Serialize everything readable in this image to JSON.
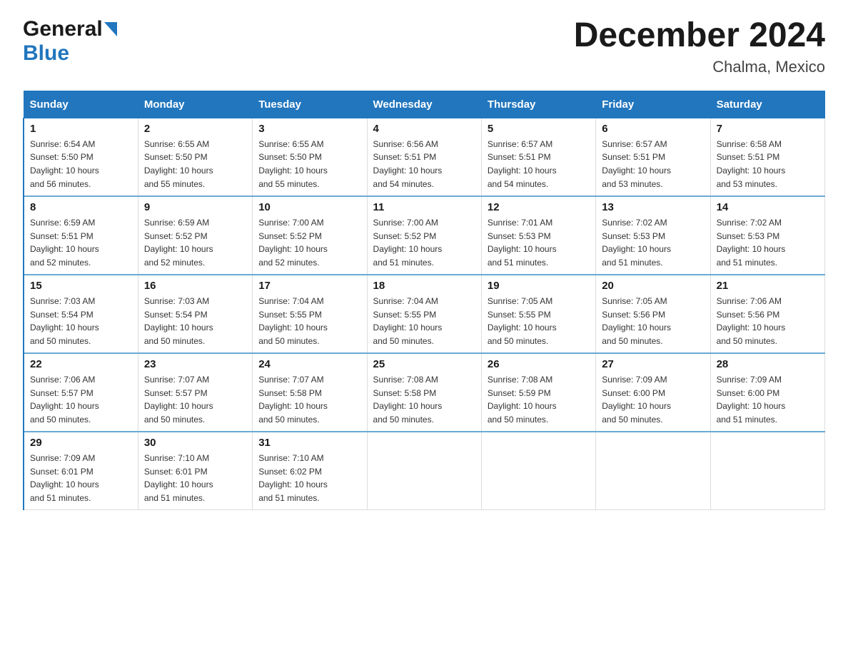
{
  "header": {
    "logo_text_general": "General",
    "logo_text_blue": "Blue",
    "title": "December 2024",
    "subtitle": "Chalma, Mexico"
  },
  "days_of_week": [
    "Sunday",
    "Monday",
    "Tuesday",
    "Wednesday",
    "Thursday",
    "Friday",
    "Saturday"
  ],
  "weeks": [
    [
      {
        "day": "1",
        "sunrise": "6:54 AM",
        "sunset": "5:50 PM",
        "daylight": "10 hours and 56 minutes."
      },
      {
        "day": "2",
        "sunrise": "6:55 AM",
        "sunset": "5:50 PM",
        "daylight": "10 hours and 55 minutes."
      },
      {
        "day": "3",
        "sunrise": "6:55 AM",
        "sunset": "5:50 PM",
        "daylight": "10 hours and 55 minutes."
      },
      {
        "day": "4",
        "sunrise": "6:56 AM",
        "sunset": "5:51 PM",
        "daylight": "10 hours and 54 minutes."
      },
      {
        "day": "5",
        "sunrise": "6:57 AM",
        "sunset": "5:51 PM",
        "daylight": "10 hours and 54 minutes."
      },
      {
        "day": "6",
        "sunrise": "6:57 AM",
        "sunset": "5:51 PM",
        "daylight": "10 hours and 53 minutes."
      },
      {
        "day": "7",
        "sunrise": "6:58 AM",
        "sunset": "5:51 PM",
        "daylight": "10 hours and 53 minutes."
      }
    ],
    [
      {
        "day": "8",
        "sunrise": "6:59 AM",
        "sunset": "5:51 PM",
        "daylight": "10 hours and 52 minutes."
      },
      {
        "day": "9",
        "sunrise": "6:59 AM",
        "sunset": "5:52 PM",
        "daylight": "10 hours and 52 minutes."
      },
      {
        "day": "10",
        "sunrise": "7:00 AM",
        "sunset": "5:52 PM",
        "daylight": "10 hours and 52 minutes."
      },
      {
        "day": "11",
        "sunrise": "7:00 AM",
        "sunset": "5:52 PM",
        "daylight": "10 hours and 51 minutes."
      },
      {
        "day": "12",
        "sunrise": "7:01 AM",
        "sunset": "5:53 PM",
        "daylight": "10 hours and 51 minutes."
      },
      {
        "day": "13",
        "sunrise": "7:02 AM",
        "sunset": "5:53 PM",
        "daylight": "10 hours and 51 minutes."
      },
      {
        "day": "14",
        "sunrise": "7:02 AM",
        "sunset": "5:53 PM",
        "daylight": "10 hours and 51 minutes."
      }
    ],
    [
      {
        "day": "15",
        "sunrise": "7:03 AM",
        "sunset": "5:54 PM",
        "daylight": "10 hours and 50 minutes."
      },
      {
        "day": "16",
        "sunrise": "7:03 AM",
        "sunset": "5:54 PM",
        "daylight": "10 hours and 50 minutes."
      },
      {
        "day": "17",
        "sunrise": "7:04 AM",
        "sunset": "5:55 PM",
        "daylight": "10 hours and 50 minutes."
      },
      {
        "day": "18",
        "sunrise": "7:04 AM",
        "sunset": "5:55 PM",
        "daylight": "10 hours and 50 minutes."
      },
      {
        "day": "19",
        "sunrise": "7:05 AM",
        "sunset": "5:55 PM",
        "daylight": "10 hours and 50 minutes."
      },
      {
        "day": "20",
        "sunrise": "7:05 AM",
        "sunset": "5:56 PM",
        "daylight": "10 hours and 50 minutes."
      },
      {
        "day": "21",
        "sunrise": "7:06 AM",
        "sunset": "5:56 PM",
        "daylight": "10 hours and 50 minutes."
      }
    ],
    [
      {
        "day": "22",
        "sunrise": "7:06 AM",
        "sunset": "5:57 PM",
        "daylight": "10 hours and 50 minutes."
      },
      {
        "day": "23",
        "sunrise": "7:07 AM",
        "sunset": "5:57 PM",
        "daylight": "10 hours and 50 minutes."
      },
      {
        "day": "24",
        "sunrise": "7:07 AM",
        "sunset": "5:58 PM",
        "daylight": "10 hours and 50 minutes."
      },
      {
        "day": "25",
        "sunrise": "7:08 AM",
        "sunset": "5:58 PM",
        "daylight": "10 hours and 50 minutes."
      },
      {
        "day": "26",
        "sunrise": "7:08 AM",
        "sunset": "5:59 PM",
        "daylight": "10 hours and 50 minutes."
      },
      {
        "day": "27",
        "sunrise": "7:09 AM",
        "sunset": "6:00 PM",
        "daylight": "10 hours and 50 minutes."
      },
      {
        "day": "28",
        "sunrise": "7:09 AM",
        "sunset": "6:00 PM",
        "daylight": "10 hours and 51 minutes."
      }
    ],
    [
      {
        "day": "29",
        "sunrise": "7:09 AM",
        "sunset": "6:01 PM",
        "daylight": "10 hours and 51 minutes."
      },
      {
        "day": "30",
        "sunrise": "7:10 AM",
        "sunset": "6:01 PM",
        "daylight": "10 hours and 51 minutes."
      },
      {
        "day": "31",
        "sunrise": "7:10 AM",
        "sunset": "6:02 PM",
        "daylight": "10 hours and 51 minutes."
      },
      null,
      null,
      null,
      null
    ]
  ],
  "labels": {
    "sunrise": "Sunrise: ",
    "sunset": "Sunset: ",
    "daylight": "Daylight: "
  }
}
